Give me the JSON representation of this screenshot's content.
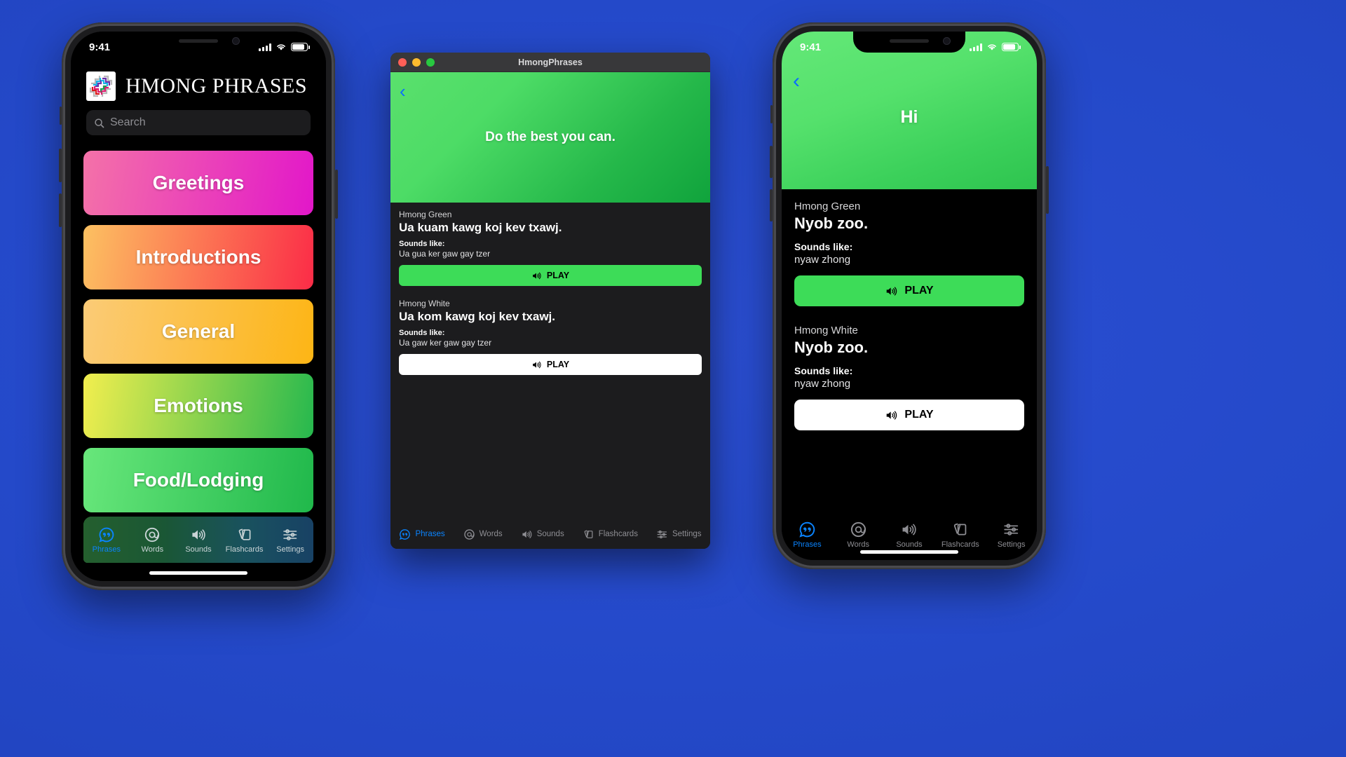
{
  "background_color": "#2449c9",
  "phone_list": {
    "status_bar": {
      "time": "9:41",
      "signal_icon": "cellular-bars-icon",
      "wifi_icon": "wifi-icon",
      "battery_icon": "battery-icon"
    },
    "header": {
      "title": "HMONG PHRASES",
      "logo_icon": "hmong-pattern-logo"
    },
    "search": {
      "placeholder": "Search",
      "icon": "search-icon"
    },
    "categories": [
      {
        "label": "Greetings",
        "gradient_from": "#f472a8",
        "gradient_to": "#e217c9"
      },
      {
        "label": "Introductions",
        "gradient_from": "#fcc161",
        "gradient_to": "#fb2c47"
      },
      {
        "label": "General",
        "gradient_from": "#fbcb77",
        "gradient_to": "#fdb515"
      },
      {
        "label": "Emotions",
        "gradient_from": "#f2ee4e",
        "gradient_to": "#26b84e"
      },
      {
        "label": "Food/Lodging",
        "gradient_from": "#68e77b",
        "gradient_to": "#20b84b"
      }
    ],
    "tabs": [
      {
        "label": "Phrases",
        "icon": "speech-bubble-quote-icon",
        "active": true
      },
      {
        "label": "Words",
        "icon": "at-sign-icon",
        "active": false
      },
      {
        "label": "Sounds",
        "icon": "speaker-wave-icon",
        "active": false
      },
      {
        "label": "Flashcards",
        "icon": "cards-stack-icon",
        "active": false
      },
      {
        "label": "Settings",
        "icon": "sliders-icon",
        "active": false
      }
    ],
    "tab_active_color": "#0a84ff"
  },
  "mac_window": {
    "title": "HmongPhrases",
    "traffic_lights": {
      "close": "#ff5f57",
      "minimize": "#febc2e",
      "zoom": "#28c840"
    },
    "back_icon": "chevron-left-icon",
    "hero_text": "Do the best you can.",
    "entries": [
      {
        "dialect": "Hmong Green",
        "phrase": "Ua kuam kawg koj kev txawj.",
        "sounds_like_label": "Sounds like:",
        "sounds_like": "Ua gua ker gaw gay tzer",
        "play_label": "PLAY",
        "play_icon": "speaker-wave-icon",
        "play_style": "green"
      },
      {
        "dialect": "Hmong White",
        "phrase": "Ua kom kawg koj kev txawj.",
        "sounds_like_label": "Sounds like:",
        "sounds_like": "Ua gaw ker gaw gay tzer",
        "play_label": "PLAY",
        "play_icon": "speaker-wave-icon",
        "play_style": "white"
      }
    ],
    "tabs": [
      {
        "label": "Phrases",
        "icon": "speech-bubble-quote-icon",
        "active": true
      },
      {
        "label": "Words",
        "icon": "at-sign-icon",
        "active": false
      },
      {
        "label": "Sounds",
        "icon": "speaker-wave-icon",
        "active": false
      },
      {
        "label": "Flashcards",
        "icon": "cards-stack-icon",
        "active": false
      },
      {
        "label": "Settings",
        "icon": "sliders-icon",
        "active": false
      }
    ]
  },
  "phone_detail": {
    "status_bar": {
      "time": "9:41",
      "signal_icon": "cellular-bars-icon",
      "wifi_icon": "wifi-icon",
      "battery_icon": "battery-icon"
    },
    "back_icon": "chevron-left-icon",
    "hero_text": "Hi",
    "entries": [
      {
        "dialect": "Hmong Green",
        "phrase": "Nyob zoo.",
        "sounds_like_label": "Sounds like:",
        "sounds_like": "nyaw zhong",
        "play_label": "PLAY",
        "play_icon": "speaker-wave-icon",
        "play_style": "green"
      },
      {
        "dialect": "Hmong White",
        "phrase": "Nyob zoo.",
        "sounds_like_label": "Sounds like:",
        "sounds_like": "nyaw zhong",
        "play_label": "PLAY",
        "play_icon": "speaker-wave-icon",
        "play_style": "white"
      }
    ],
    "tabs": [
      {
        "label": "Phrases",
        "icon": "speech-bubble-quote-icon",
        "active": true
      },
      {
        "label": "Words",
        "icon": "at-sign-icon",
        "active": false
      },
      {
        "label": "Sounds",
        "icon": "speaker-wave-icon",
        "active": false
      },
      {
        "label": "Flashcards",
        "icon": "cards-stack-icon",
        "active": false
      },
      {
        "label": "Settings",
        "icon": "sliders-icon",
        "active": false
      }
    ]
  }
}
